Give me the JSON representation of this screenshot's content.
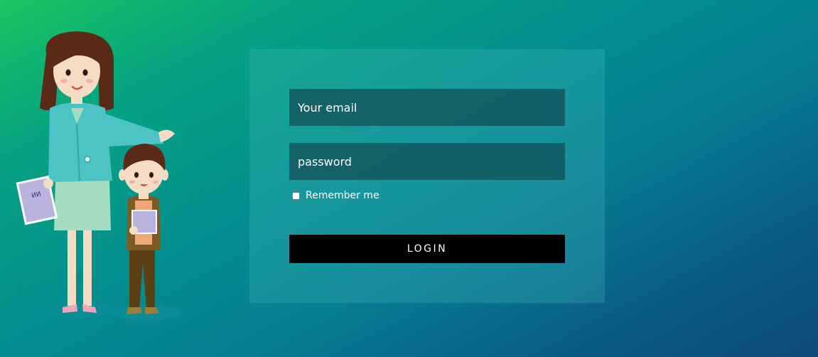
{
  "login_form": {
    "email_placeholder": "Your email",
    "password_placeholder": "password",
    "remember_label": "Remember me",
    "remember_checked": false,
    "login_label": "LOGIN"
  },
  "illustration": {
    "book_text": "ИИ"
  },
  "colors": {
    "background_start": "#19c65f",
    "background_end": "#0c4a7a",
    "button": "#000000",
    "field": "#12525a"
  }
}
